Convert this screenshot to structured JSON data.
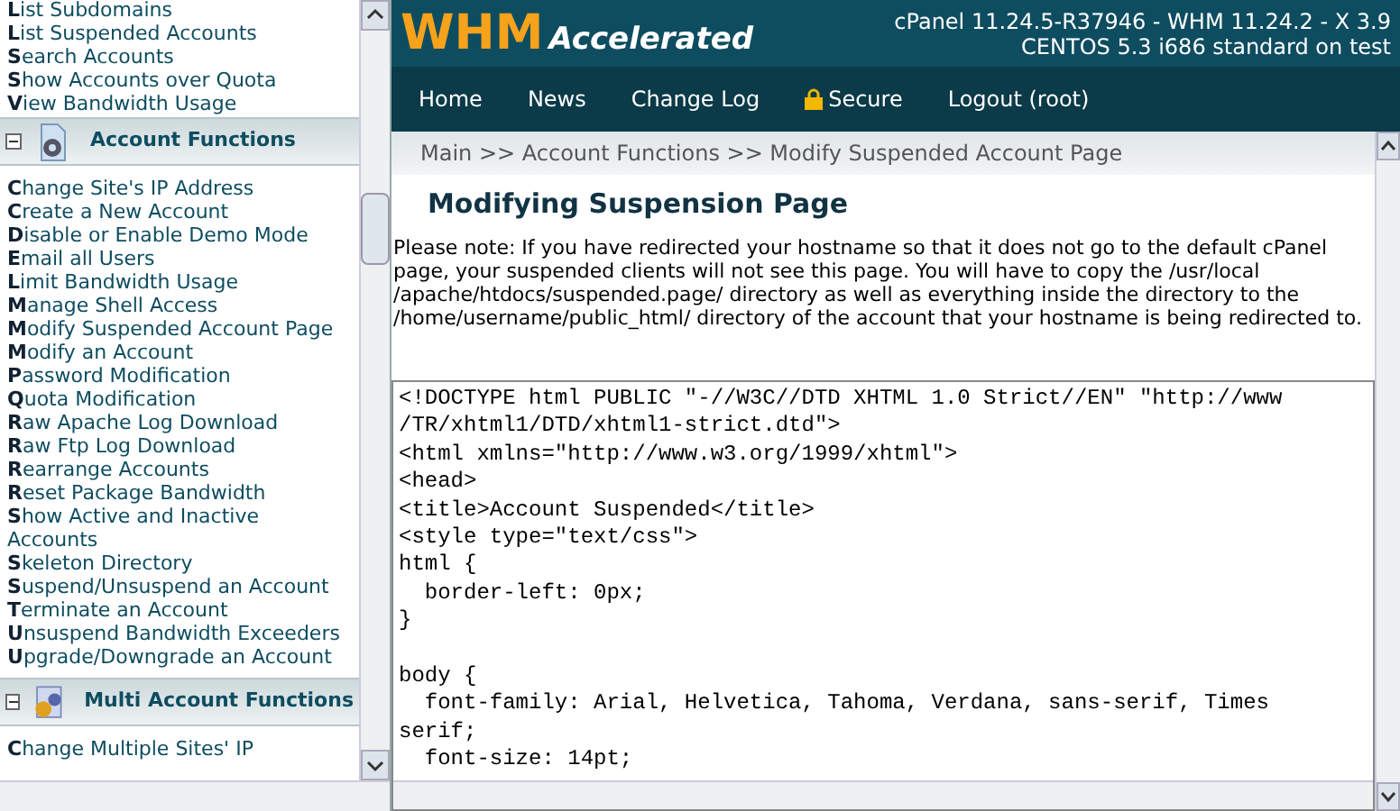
{
  "sidebar": {
    "top_items": [
      "List Subdomains",
      "List Suspended Accounts",
      "Search Accounts",
      "Show Accounts over Quota",
      "View Bandwidth Usage"
    ],
    "sections": [
      {
        "title": "Account Functions",
        "expanded": true,
        "kind": "single",
        "items": [
          "Change Site's IP Address",
          "Create a New Account",
          "Disable or Enable Demo Mode",
          "Email all Users",
          "Limit Bandwidth Usage",
          "Manage Shell Access",
          "Modify Suspended Account Page",
          "Modify an Account",
          "Password Modification",
          "Quota Modification",
          "Raw Apache Log Download",
          "Raw Ftp Log Download",
          "Rearrange Accounts",
          "Reset Package Bandwidth",
          "Show Active and Inactive Accounts",
          "Skeleton Directory",
          "Suspend/Unsuspend an Account",
          "Terminate an Account",
          "Unsuspend Bandwidth Exceeders",
          "Upgrade/Downgrade an Account"
        ]
      },
      {
        "title": "Multi Account Functions",
        "expanded": true,
        "kind": "multi",
        "items": [
          "Change Multiple Sites' IP"
        ]
      }
    ]
  },
  "header": {
    "logo_main": "WHM",
    "logo_sub": "Accelerated",
    "version_lines": [
      "cPanel 11.24.5-R37946 - WHM 11.24.2 - X 3.9",
      "CENTOS 5.3 i686 standard on test"
    ]
  },
  "nav": [
    {
      "label": "Home",
      "kind": "link"
    },
    {
      "label": "News",
      "kind": "link"
    },
    {
      "label": "Change Log",
      "kind": "link"
    },
    {
      "label": "Secure",
      "kind": "secure"
    },
    {
      "label": "Logout (root)",
      "kind": "link"
    }
  ],
  "breadcrumb": "Main >> Account Functions >> Modify Suspended Account Page",
  "page_title": "Modifying Suspension Page",
  "note": "Please note: If you have redirected your hostname so that it does not go to the default cPanel page, your suspended clients will not see this page. You will have to copy the /usr/local /apache/htdocs/suspended.page/ directory as well as everything inside the directory to the /home/username/public_html/ directory of the account that your hostname is being redirected to.",
  "code": "<!DOCTYPE html PUBLIC \"-//W3C//DTD XHTML 1.0 Strict//EN\" \"http://www\n/TR/xhtml1/DTD/xhtml1-strict.dtd\">\n<html xmlns=\"http://www.w3.org/1999/xhtml\">\n<head>\n<title>Account Suspended</title>\n<style type=\"text/css\">\nhtml {\n  border-left: 0px;\n}\n\nbody {\n  font-family: Arial, Helvetica, Tahoma, Verdana, sans-serif, Times\nserif;\n  font-size: 14pt;"
}
